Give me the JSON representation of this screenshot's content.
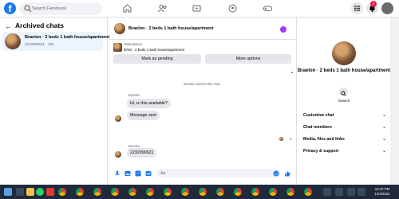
{
  "topbar": {
    "search_placeholder": "Search Facebook",
    "notification_count": "1"
  },
  "sidebar": {
    "title": "Archived chats",
    "chat": {
      "name": "Braelon · 2 beds 1 bath house/apartment",
      "sub": "2232990621 · 15h"
    }
  },
  "chat": {
    "header_title": "Braelon · 2 beds 1 bath house/apartment",
    "marketplace_label": "Marketplace",
    "listing": "$700 · 2 beds 1 bath house/apartment",
    "pending_button": "Mark as pending",
    "more_button": "More options",
    "started_text": "Braelon started this chat.",
    "messages": [
      {
        "sender": "Braelon",
        "text": "Hi, is this available?"
      },
      {
        "sender": "",
        "text": "Message sent"
      },
      {
        "sender": "Braelon",
        "text": "2232990621"
      }
    ],
    "input_placeholder": "Aa"
  },
  "rpanel": {
    "name": "Braelon · 2 beds 1 bath house/apartment",
    "search_label": "Search",
    "sections": [
      "Customize chat",
      "Chat members",
      "Media, files and links",
      "Privacy & support"
    ]
  },
  "taskbar": {
    "time": "10:47 PM",
    "date": "1/22/2024"
  },
  "colors": {
    "accent": "#1877f2",
    "selected_bg": "#ebf5ff",
    "bubble_bg": "#e4e6eb",
    "taskbar_bg": "#202a3a",
    "info_purple": "#a33bf0"
  }
}
